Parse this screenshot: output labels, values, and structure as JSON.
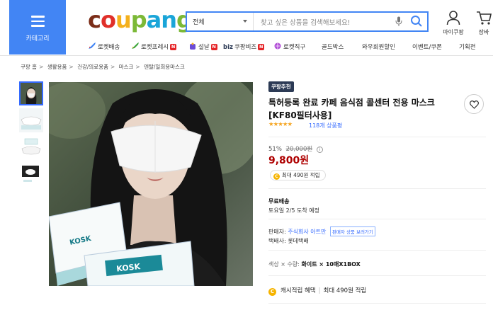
{
  "header": {
    "category_label": "카테고리",
    "logo": [
      "c",
      "o",
      "u",
      "p",
      "a",
      "n",
      "g"
    ],
    "logo_colors": [
      "#7b2d18",
      "#e0302a",
      "#f4b01c",
      "#7cb937",
      "#1aa5d8",
      "#1aa5d8",
      "#7cb937"
    ],
    "search_category": "전체",
    "search_placeholder": "찾고 싶은 상품을 검색해보세요!",
    "mypage_label": "마이쿠팡",
    "cart_label": "장바"
  },
  "catbar": [
    {
      "label": "로켓배송",
      "icon": "rocket-icon",
      "badge": ""
    },
    {
      "label": "로켓프레시",
      "icon": "rocket-fresh-icon",
      "badge": "N"
    },
    {
      "label": "설날",
      "icon": "seollal-icon",
      "badge": "N"
    },
    {
      "label": "쿠팡비즈",
      "icon": "biz-logo",
      "prefix": "biz",
      "badge": "N"
    },
    {
      "label": "로켓직구",
      "icon": "global-icon",
      "badge": ""
    },
    {
      "label": "골드박스",
      "icon": "",
      "badge": ""
    },
    {
      "label": "와우회원할인",
      "icon": "",
      "badge": ""
    },
    {
      "label": "이벤트/쿠폰",
      "icon": "",
      "badge": ""
    },
    {
      "label": "기획전",
      "icon": "",
      "badge": ""
    }
  ],
  "breadcrumb": [
    "쿠팡 홈",
    "생활용품",
    "건강/의료용품",
    "마스크",
    "덴탈/일회용마스크"
  ],
  "product": {
    "badge": "쿠팡추천",
    "title": "특허등록 완료 카페 음식점 콜센터 전용 마스크 [KF80필터사용]",
    "stars": "★★★★★",
    "review_count": "118개 상품평",
    "discount_rate": "51%",
    "original_price": "20,000원",
    "price": "9,800원",
    "reward": "최대 490원 적립",
    "shipping_title": "무료배송",
    "shipping_date": "토요일 2/5 도착 예정",
    "seller_label": "판매자:",
    "seller_name": "주식회사 아트만",
    "seller_more": "판매자 상품 보러가기",
    "courier": "택배사: 롯데택배",
    "option_prefix": "색상 × 수량:",
    "option_value": "화이트 × 10매X1BOX",
    "cash_label": "캐시적립 혜택",
    "cash_value": "최대 490원 적립",
    "box_brand": "KOSK"
  },
  "colors": {
    "accent": "#4285f4",
    "price": "#ae0000",
    "link": "#346aff"
  }
}
